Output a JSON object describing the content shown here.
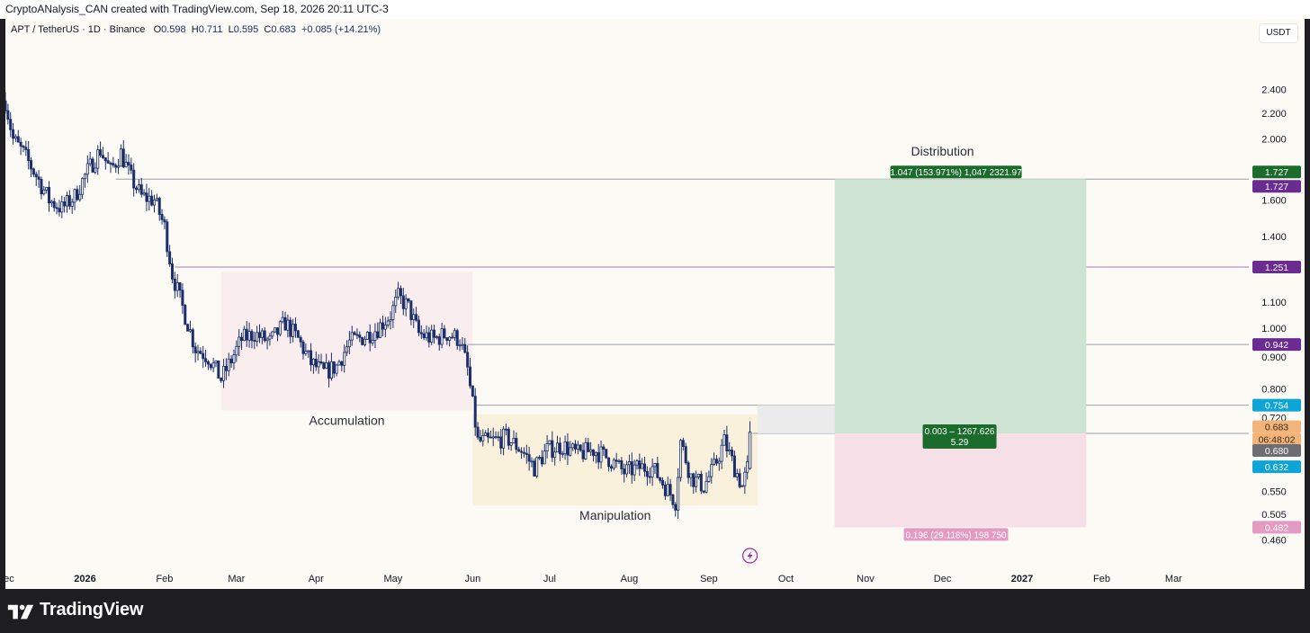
{
  "header": {
    "caption": "CryptoANalysis_CAN created with TradingView.com, Sep 18, 2026 20:11 UTC-3"
  },
  "legend": {
    "symbol": "APT / TetherUS · 1D · Binance",
    "open_label": "O",
    "open": "0.598",
    "high_label": "H",
    "high": "0.711",
    "low_label": "L",
    "low": "0.595",
    "close_label": "C",
    "close": "0.683",
    "change": "+0.085 (+14.21%)"
  },
  "currency": "USDT",
  "footer": {
    "brand": "TradingView"
  },
  "colors": {
    "candle": "#1c2f6b",
    "accumulation_zone": "#f9eded",
    "manipulation_zone": "#faf1dc",
    "profit_zone": "#cfe3d3",
    "loss_zone": "#f7dfe7",
    "target_tag": "#1a6b2c",
    "level_tag": "#6a2c91",
    "blue_tag": "#0ea5d6",
    "loss_tag": "#e49ac2",
    "price_tag": "#f2b47a"
  },
  "chart_data": {
    "type": "candlestick",
    "symbol": "APT/USDT",
    "interval": "1D",
    "y_scale": "log",
    "ylim": [
      0.43,
      2.55
    ],
    "y_ticks": [
      2.4,
      2.2,
      2.0,
      1.6,
      1.4,
      1.1,
      1.0,
      0.9,
      0.8,
      0.72,
      0.55,
      0.505,
      0.46
    ],
    "y_tick_labels": [
      "2.400",
      "2.200",
      "2.000",
      "1.600",
      "1.400",
      "1.100",
      "1.000",
      "0.900",
      "0.800",
      "0.720",
      "0.550",
      "0.505",
      "0.460"
    ],
    "x_range": [
      "2025-12-01",
      "2027-03-31"
    ],
    "x_ticks": [
      {
        "label": "Dec",
        "date": "2025-12-01",
        "bold": false
      },
      {
        "label": "2026",
        "date": "2026-01-01",
        "bold": true
      },
      {
        "label": "Feb",
        "date": "2026-02-01",
        "bold": false
      },
      {
        "label": "Mar",
        "date": "2026-03-01",
        "bold": false
      },
      {
        "label": "Apr",
        "date": "2026-04-01",
        "bold": false
      },
      {
        "label": "May",
        "date": "2026-05-01",
        "bold": false
      },
      {
        "label": "Jun",
        "date": "2026-06-01",
        "bold": false
      },
      {
        "label": "Jul",
        "date": "2026-07-01",
        "bold": false
      },
      {
        "label": "Aug",
        "date": "2026-08-01",
        "bold": false
      },
      {
        "label": "Sep",
        "date": "2026-09-01",
        "bold": false
      },
      {
        "label": "Oct",
        "date": "2026-10-01",
        "bold": false
      },
      {
        "label": "Nov",
        "date": "2026-11-01",
        "bold": false
      },
      {
        "label": "Dec",
        "date": "2026-12-01",
        "bold": false
      },
      {
        "label": "2027",
        "date": "2027-01-01",
        "bold": true
      },
      {
        "label": "Feb",
        "date": "2027-02-01",
        "bold": false
      },
      {
        "label": "Mar",
        "date": "2027-03-01",
        "bold": false
      }
    ],
    "price_path": [
      [
        "2025-12-01",
        2.3
      ],
      [
        "2025-12-04",
        2.0
      ],
      [
        "2025-12-08",
        1.9
      ],
      [
        "2025-12-13",
        1.75
      ],
      [
        "2025-12-18",
        1.6
      ],
      [
        "2025-12-23",
        1.55
      ],
      [
        "2025-12-28",
        1.62
      ],
      [
        "2026-01-02",
        1.78
      ],
      [
        "2026-01-07",
        1.92
      ],
      [
        "2026-01-11",
        1.78
      ],
      [
        "2026-01-15",
        1.9
      ],
      [
        "2026-01-19",
        1.73
      ],
      [
        "2026-01-23",
        1.62
      ],
      [
        "2026-01-28",
        1.6
      ],
      [
        "2026-02-01",
        1.45
      ],
      [
        "2026-02-04",
        1.22
      ],
      [
        "2026-02-08",
        1.08
      ],
      [
        "2026-02-13",
        0.93
      ],
      [
        "2026-02-18",
        0.9
      ],
      [
        "2026-02-23",
        0.83
      ],
      [
        "2026-02-27",
        0.89
      ],
      [
        "2026-03-03",
        0.96
      ],
      [
        "2026-03-08",
        0.98
      ],
      [
        "2026-03-14",
        0.95
      ],
      [
        "2026-03-20",
        1.02
      ],
      [
        "2026-03-25",
        0.96
      ],
      [
        "2026-03-30",
        0.88
      ],
      [
        "2026-04-04",
        0.85
      ],
      [
        "2026-04-09",
        0.87
      ],
      [
        "2026-04-14",
        0.95
      ],
      [
        "2026-04-20",
        0.97
      ],
      [
        "2026-04-25",
        1.0
      ],
      [
        "2026-04-30",
        1.05
      ],
      [
        "2026-05-03",
        1.12
      ],
      [
        "2026-05-07",
        1.08
      ],
      [
        "2026-05-11",
        0.98
      ],
      [
        "2026-05-17",
        0.96
      ],
      [
        "2026-05-22",
        0.98
      ],
      [
        "2026-05-27",
        0.96
      ],
      [
        "2026-05-30",
        0.86
      ],
      [
        "2026-06-03",
        0.66
      ],
      [
        "2026-06-08",
        0.66
      ],
      [
        "2026-06-14",
        0.67
      ],
      [
        "2026-06-20",
        0.64
      ],
      [
        "2026-06-25",
        0.6
      ],
      [
        "2026-06-30",
        0.64
      ],
      [
        "2026-07-06",
        0.65
      ],
      [
        "2026-07-12",
        0.63
      ],
      [
        "2026-07-18",
        0.64
      ],
      [
        "2026-07-24",
        0.62
      ],
      [
        "2026-07-30",
        0.59
      ],
      [
        "2026-08-05",
        0.6
      ],
      [
        "2026-08-10",
        0.6
      ],
      [
        "2026-08-15",
        0.56
      ],
      [
        "2026-08-19",
        0.53
      ],
      [
        "2026-08-21",
        0.66
      ],
      [
        "2026-08-25",
        0.58
      ],
      [
        "2026-08-30",
        0.56
      ],
      [
        "2026-09-03",
        0.6
      ],
      [
        "2026-09-07",
        0.66
      ],
      [
        "2026-09-11",
        0.6
      ],
      [
        "2026-09-14",
        0.56
      ],
      [
        "2026-09-16",
        0.598
      ],
      [
        "2026-09-17",
        0.683
      ]
    ],
    "last_bar": {
      "date": "2026-09-17",
      "open": 0.598,
      "high": 0.711,
      "low": 0.595,
      "close": 0.683
    },
    "horizontal_levels": [
      {
        "price": 1.727,
        "start": "2026-01-13"
      },
      {
        "price": 1.251,
        "start": "2026-02-05"
      },
      {
        "price": 0.942,
        "start": "2026-05-30"
      },
      {
        "price": 0.754,
        "start": "2026-06-02"
      },
      {
        "price": 0.68,
        "start": "2026-09-18"
      }
    ],
    "zones": [
      {
        "label": "Accumulation",
        "start": "2026-02-23",
        "end": "2026-06-01",
        "top": 1.23,
        "bottom": 0.74
      },
      {
        "label": "Manipulation",
        "start": "2026-06-01",
        "end": "2026-09-20",
        "top": 0.729,
        "bottom": 0.522
      }
    ],
    "position_tool": {
      "start": "2026-10-20",
      "end": "2027-01-26",
      "pending_start": "2026-09-20",
      "entry": 0.68,
      "stop": 0.482,
      "target": 1.727,
      "title": "Distribution",
      "target_label": "1.047 (153.971%) 1,047 2321.97",
      "center_label_1": "0.003 – 1267.626",
      "center_label_2": "5.29",
      "stop_label": "0.196 (29.118%) 198 750"
    },
    "price_tags": [
      {
        "text": "1.727",
        "price": 1.727,
        "color": "#1a6b2c",
        "shift": -8
      },
      {
        "text": "1.727",
        "price": 1.727,
        "color": "#6a2c91",
        "shift": 8
      },
      {
        "text": "1.251",
        "price": 1.251,
        "color": "#6a2c91",
        "shift": 0
      },
      {
        "text": "0.942",
        "price": 0.942,
        "color": "#6a2c91",
        "shift": 0
      },
      {
        "text": "0.754",
        "price": 0.754,
        "color": "#0ea5d6",
        "shift": 0
      },
      {
        "text": "0.683",
        "price": 0.683,
        "color": "#f2b47a",
        "shift": -6,
        "dark_text": true
      },
      {
        "text": "06:48:02",
        "price": 0.683,
        "color": "#f2b47a",
        "shift": 8,
        "dark_text": true
      },
      {
        "text": "0.680",
        "price": 0.68,
        "color": "#6d6d74",
        "shift": 19
      },
      {
        "text": "0.632",
        "price": 0.632,
        "color": "#0ea5d6",
        "shift": 15
      },
      {
        "text": "0.482",
        "price": 0.482,
        "color": "#e49ac2",
        "shift": 0
      }
    ]
  }
}
